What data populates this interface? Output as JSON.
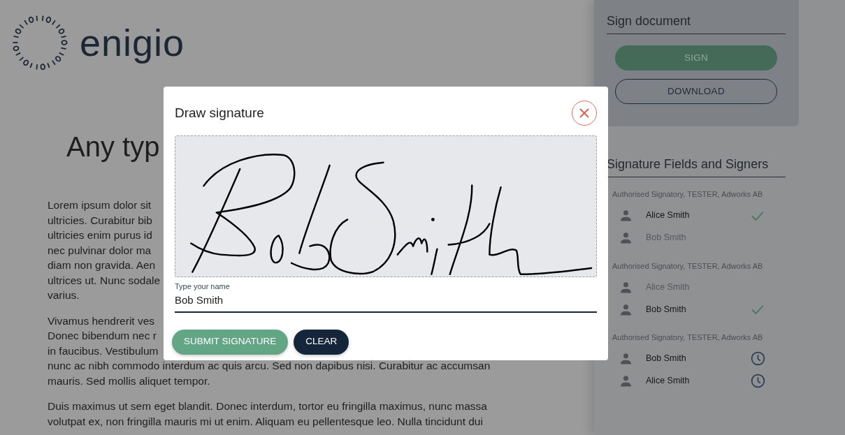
{
  "logo": {
    "wordmark": "enigio"
  },
  "document": {
    "heading": "Any typ",
    "paragraphs": [
      [
        "Lorem ipsum dolor sit",
        "ultricies. Curabitur bib",
        "ultricies enim purus id",
        "nec pulvinar dolor ma",
        "diam non gravida. Aen",
        "ultrices ut. Nunc sodale",
        "varius."
      ],
      [
        "Vivamus hendrerit ves",
        "Donec bibendum nec r",
        "in faucibus. Vestibulum",
        "nunc ac nibh commodo interdum ac quis arcu. Sed non dapibus nisi. Curabitur ac accumsan",
        "mauris. Sed mollis aliquet tempor."
      ],
      [
        "Duis maximus ut sem eget blandit. Donec interdum, tortor eu fringilla maximus, nunc massa",
        "volutpat ex, non fringilla mauris mi ut enim. Aliquam eu pellentesque leo. Nulla tincidunt dui"
      ]
    ]
  },
  "sign_panel": {
    "title": "Sign document",
    "buttons": [
      {
        "label": "SIGN",
        "kind": "primary",
        "disabled": true
      },
      {
        "label": "DOWNLOAD",
        "kind": "outline",
        "disabled": false
      }
    ]
  },
  "signers_panel": {
    "title": "Signature Fields and Signers",
    "groups": [
      {
        "role": "Authorised Signatory, TESTER, Adworks AB",
        "signers": [
          {
            "name": "Alice Smith",
            "dimmed": false,
            "kind": "signed"
          },
          {
            "name": "Bob Smith",
            "dimmed": true,
            "kind": "plain"
          }
        ]
      },
      {
        "role": "Authorised Signatory, TESTER, Adworks AB",
        "signers": [
          {
            "name": "Alice Smith",
            "dimmed": true,
            "kind": "plain"
          },
          {
            "name": "Bob Smith",
            "dimmed": false,
            "kind": "signed"
          }
        ]
      },
      {
        "role": "Authorised Signatory, TESTER, Adworks AB",
        "signers": [
          {
            "name": "Bob Smith",
            "dimmed": false,
            "kind": "pending"
          },
          {
            "name": "Alice Smith",
            "dimmed": false,
            "kind": "pending"
          }
        ]
      }
    ]
  },
  "modal": {
    "title": "Draw signature",
    "name_field": {
      "label": "Type your name",
      "value": "Bob Smith"
    },
    "buttons": [
      {
        "label": "SUBMIT SIGNATURE",
        "kind": "success"
      },
      {
        "label": "CLEAR",
        "kind": "dark"
      }
    ]
  }
}
